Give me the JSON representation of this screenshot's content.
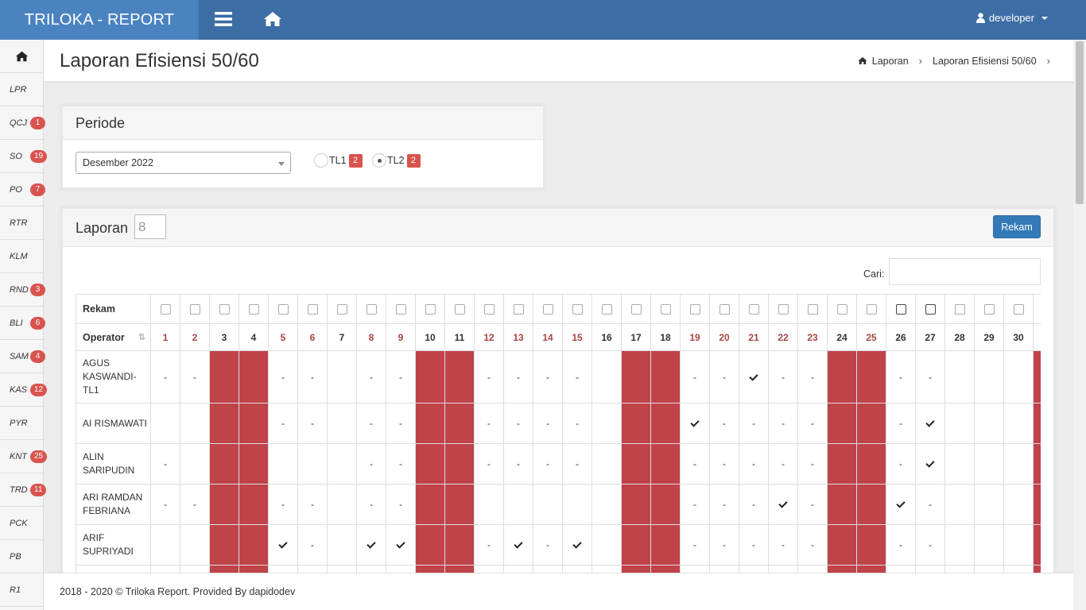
{
  "brand": "TRILOKA - REPORT",
  "header": {
    "user": "developer"
  },
  "sidebar": {
    "items": [
      {
        "label": "LPR",
        "badge": ""
      },
      {
        "label": "QCJ",
        "badge": "1"
      },
      {
        "label": "SO",
        "badge": "19"
      },
      {
        "label": "PO",
        "badge": "7"
      },
      {
        "label": "RTR",
        "badge": ""
      },
      {
        "label": "KLM",
        "badge": ""
      },
      {
        "label": "RND",
        "badge": "3"
      },
      {
        "label": "BLI",
        "badge": "6"
      },
      {
        "label": "SAM",
        "badge": "4"
      },
      {
        "label": "KAS",
        "badge": "12"
      },
      {
        "label": "PYR",
        "badge": ""
      },
      {
        "label": "KNT",
        "badge": "25"
      },
      {
        "label": "TRD",
        "badge": "11"
      },
      {
        "label": "PCK",
        "badge": ""
      },
      {
        "label": "PB",
        "badge": ""
      },
      {
        "label": "R1",
        "badge": ""
      }
    ]
  },
  "page": {
    "title": "Laporan Efisiensi 50/60",
    "breadcrumb": [
      "Laporan",
      "Laporan Efisiensi 50/60"
    ]
  },
  "periode": {
    "title": "Periode",
    "selected": "Desember 2022",
    "radios": [
      {
        "label": "TL1",
        "badge": "2",
        "checked": false
      },
      {
        "label": "TL2",
        "badge": "2",
        "checked": true
      }
    ]
  },
  "laporan": {
    "title": "Laporan",
    "count": "8",
    "button": "Rekam",
    "search_label": "Cari:",
    "table": {
      "rekam_label": "Rekam",
      "operator_label": "Operator",
      "days": [
        "1",
        "2",
        "3",
        "4",
        "5",
        "6",
        "7",
        "8",
        "9",
        "10",
        "11",
        "12",
        "13",
        "14",
        "15",
        "16",
        "17",
        "18",
        "19",
        "20",
        "21",
        "22",
        "23",
        "24",
        "25",
        "26",
        "27",
        "28",
        "29",
        "30"
      ],
      "red_days": [
        "1",
        "2",
        "5",
        "6",
        "8",
        "9",
        "12",
        "13",
        "14",
        "15",
        "19",
        "20",
        "21",
        "22",
        "23",
        "25"
      ],
      "holidays": [
        "3",
        "4",
        "10",
        "11",
        "17",
        "18",
        "24",
        "25"
      ],
      "dark_checkbox_days": [
        "26",
        "27"
      ],
      "rows": [
        {
          "name": "AGUS KASWANDI-TL1",
          "cells": [
            "-",
            "-",
            "",
            "",
            "-",
            "-",
            "",
            "-",
            "-",
            "",
            "",
            "-",
            "-",
            "-",
            "-",
            "",
            "",
            "",
            "-",
            "-",
            "v",
            "-",
            "-",
            "",
            "",
            "-",
            "-",
            "",
            "",
            ""
          ]
        },
        {
          "name": "AI RISMAWATI",
          "cells": [
            "",
            "",
            "",
            "",
            "-",
            "-",
            "",
            "-",
            "-",
            "",
            "",
            "-",
            "-",
            "-",
            "-",
            "",
            "",
            "",
            "v",
            "-",
            "-",
            "-",
            "-",
            "",
            "",
            "-",
            "v",
            "",
            "",
            ""
          ]
        },
        {
          "name": "ALIN SARIPUDIN",
          "cells": [
            "-",
            "",
            "",
            "",
            "",
            "",
            "",
            "-",
            "-",
            "",
            "",
            "-",
            "-",
            "-",
            "-",
            "",
            "",
            "",
            "-",
            "-",
            "-",
            "-",
            "-",
            "",
            "",
            "-",
            "v",
            "",
            "",
            ""
          ]
        },
        {
          "name": "ARI RAMDAN FEBRIANA",
          "cells": [
            "-",
            "-",
            "",
            "",
            "-",
            "-",
            "",
            "-",
            "-",
            "",
            "",
            "",
            "",
            "",
            "",
            "",
            "",
            "",
            "-",
            "-",
            "-",
            "v",
            "-",
            "",
            "",
            "v",
            "-",
            "",
            "",
            ""
          ]
        },
        {
          "name": "ARIF SUPRIYADI",
          "cells": [
            "",
            "",
            "",
            "",
            "v",
            "-",
            "",
            "v",
            "v",
            "",
            "",
            "-",
            "v",
            "-",
            "v",
            "",
            "",
            "",
            "-",
            "-",
            "-",
            "-",
            "-",
            "",
            "",
            "-",
            "-",
            "",
            "",
            ""
          ]
        }
      ]
    }
  },
  "footer": "2018 - 2020 © Triloka Report. Provided By dapidodev"
}
